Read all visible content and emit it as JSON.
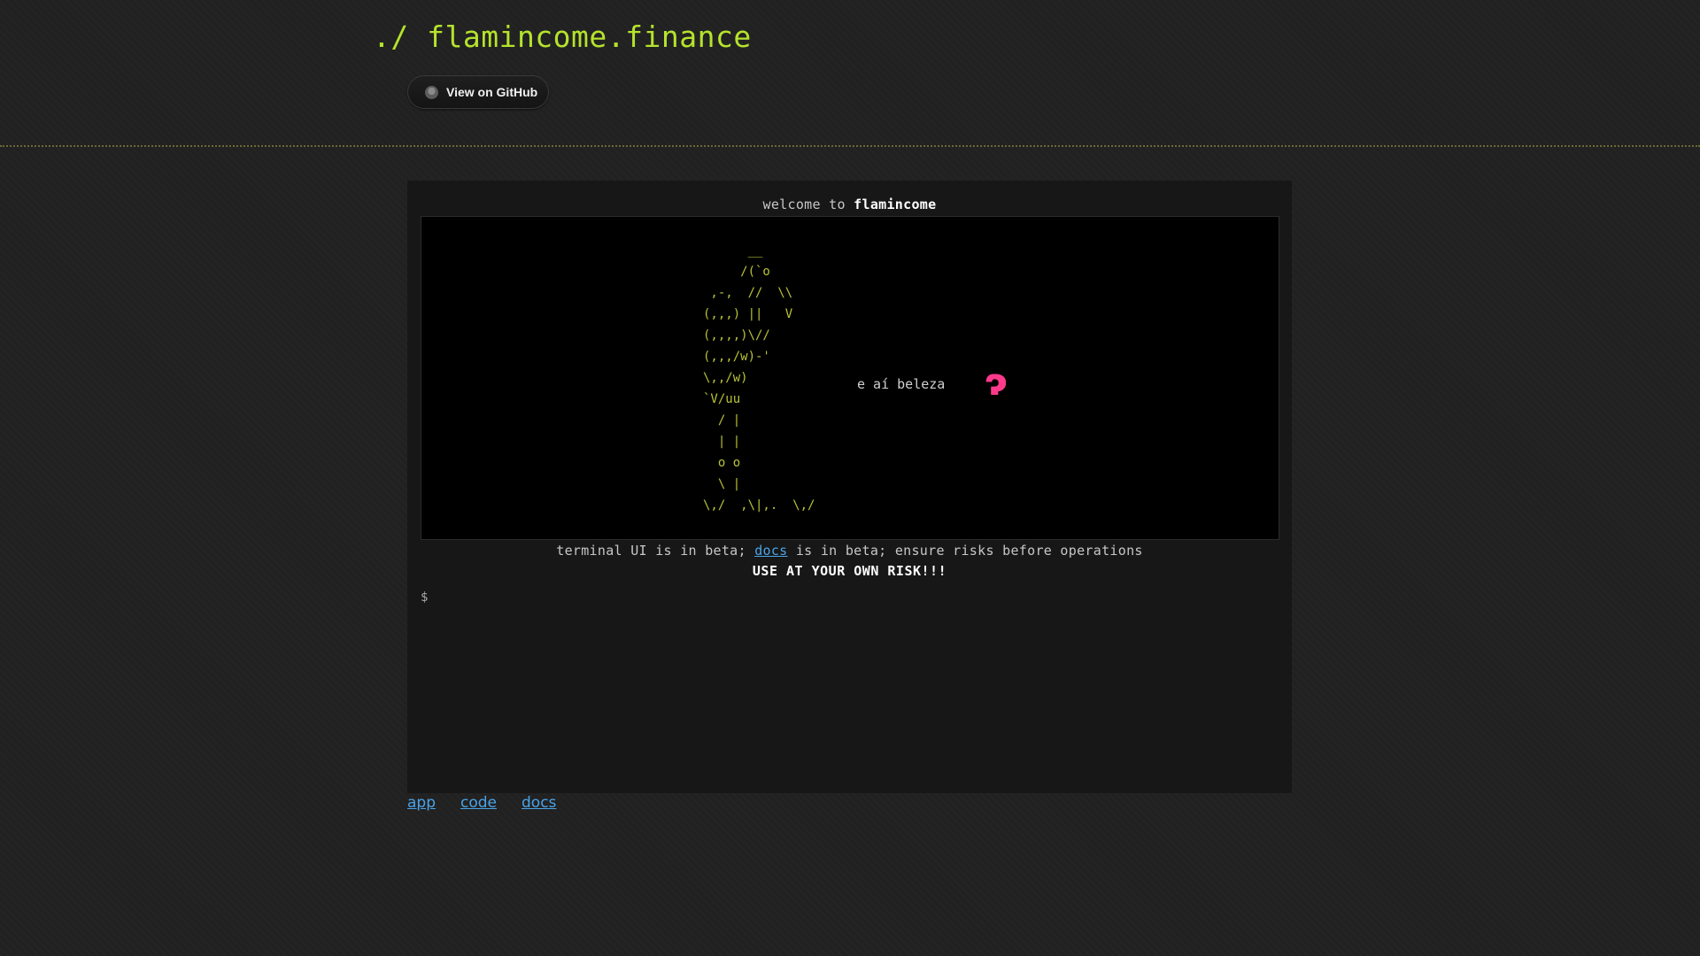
{
  "header": {
    "title": "./ flamincome.finance",
    "github_button_label": "View on GitHub"
  },
  "terminal": {
    "welcome_prefix": "welcome to ",
    "welcome_name": "flamincome",
    "ascii_art": "      __\n     /(`o\n ,-,  //  \\\\\n(,,,) ||   V\n(,,,,)\\//\n(,,,/w)-'\n\\,,/w)\n`V/uu\n  / |\n  | |\n  o o\n  \\ |\n\\,/  ,\\|,.  \\,/",
    "greeting": "e aí beleza",
    "greeting_glyph": "ɂ",
    "notice_prefix": "terminal UI is in beta; ",
    "notice_link": "docs",
    "notice_suffix": " is in beta; ensure risks before operations",
    "warning": "USE AT YOUR OWN RISK!!!",
    "prompt_symbol": "$",
    "prompt_value": ""
  },
  "footer": {
    "links": [
      "app",
      "code",
      "docs"
    ]
  },
  "colors": {
    "accent": "#b5e32d",
    "ascii": "#b9c236",
    "link": "#4aa3e8",
    "heart_start": "#c23bff",
    "heart_end": "#ff2f85"
  }
}
